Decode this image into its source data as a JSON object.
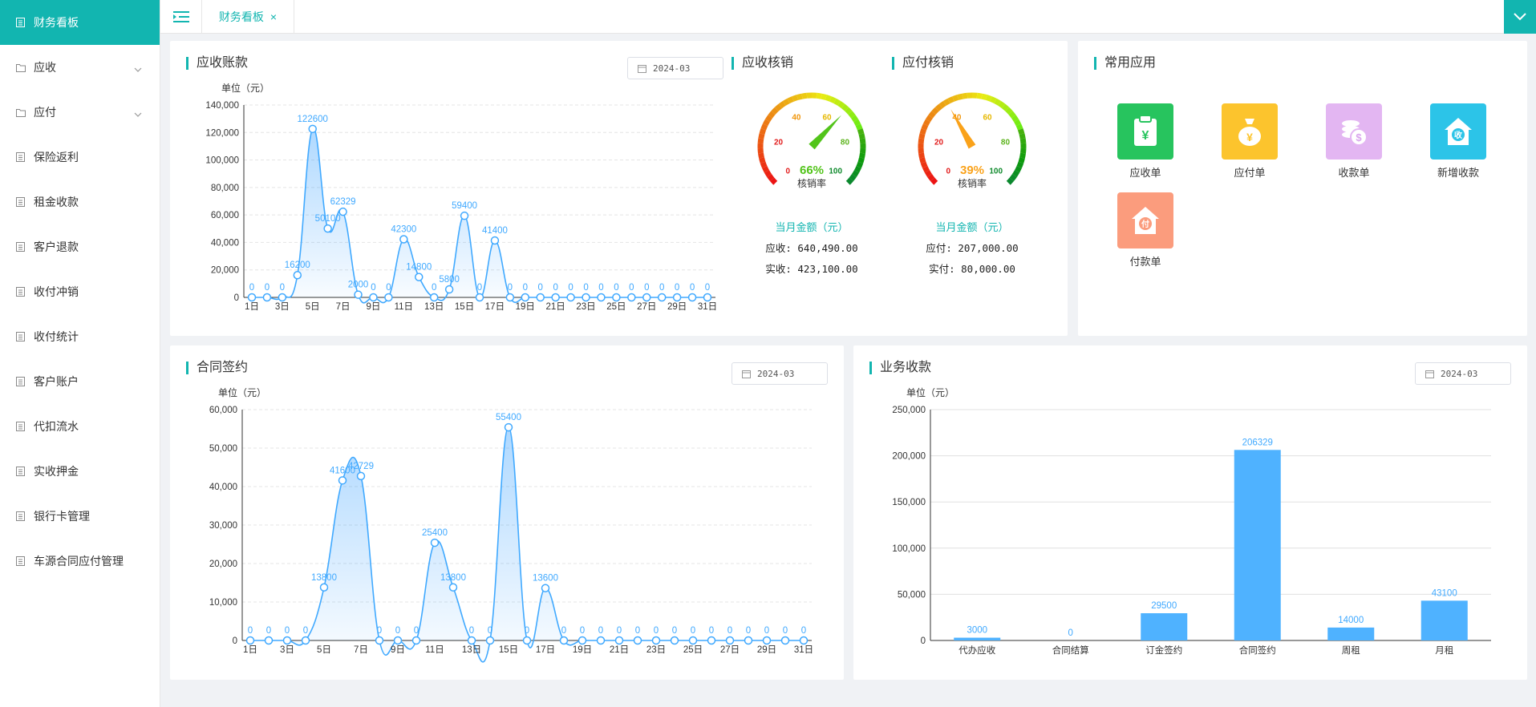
{
  "sidebar": {
    "items": [
      {
        "label": "财务看板",
        "active": true
      },
      {
        "label": "应收",
        "expandable": true
      },
      {
        "label": "应付",
        "expandable": true
      },
      {
        "label": "保险返利"
      },
      {
        "label": "租金收款"
      },
      {
        "label": "客户退款"
      },
      {
        "label": "收付冲销"
      },
      {
        "label": "收付统计"
      },
      {
        "label": "客户账户"
      },
      {
        "label": "代扣流水"
      },
      {
        "label": "实收押金"
      },
      {
        "label": "银行卡管理"
      },
      {
        "label": "车源合同应付管理"
      }
    ]
  },
  "topbar": {
    "tab_label": "财务看板",
    "tab_close": "×"
  },
  "receivables": {
    "title": "应收账款",
    "date": "2024-03",
    "unit": "单位（元）",
    "chart_data": {
      "type": "area",
      "x": [
        "1日",
        "2日",
        "3日",
        "4日",
        "5日",
        "6日",
        "7日",
        "8日",
        "9日",
        "10日",
        "11日",
        "12日",
        "13日",
        "14日",
        "15日",
        "16日",
        "17日",
        "18日",
        "19日",
        "20日",
        "21日",
        "22日",
        "23日",
        "24日",
        "25日",
        "26日",
        "27日",
        "28日",
        "29日",
        "30日",
        "31日"
      ],
      "xticks": [
        "1日",
        "3日",
        "5日",
        "7日",
        "9日",
        "11日",
        "13日",
        "15日",
        "17日",
        "19日",
        "21日",
        "23日",
        "25日",
        "27日",
        "29日",
        "31日"
      ],
      "values": [
        0,
        0,
        0,
        16200,
        122600,
        50100,
        62329,
        2000,
        0,
        0,
        42300,
        14800,
        0,
        5800,
        59400,
        0,
        41400,
        0,
        0,
        0,
        0,
        0,
        0,
        0,
        0,
        0,
        0,
        0,
        0,
        0,
        0
      ],
      "labels": [
        "0",
        "0",
        "0",
        "16200",
        "122600",
        "50100",
        "62329",
        "2000",
        "0",
        "0",
        "42300",
        "14800",
        "0",
        "5800",
        "59400",
        "0",
        "41400",
        "0",
        "0",
        "0",
        "0",
        "0",
        "0",
        "0",
        "0",
        "0",
        "0",
        "0",
        "0",
        "0",
        "0"
      ],
      "yticks": [
        "0",
        "20,000",
        "40,000",
        "60,000",
        "80,000",
        "100,000",
        "120,000",
        "140,000"
      ],
      "ylim": [
        0,
        140000
      ]
    }
  },
  "ar_writeoff": {
    "title": "应收核销",
    "gauge": {
      "value": 66,
      "label": "66%",
      "caption": "核销率",
      "ticks": [
        "0",
        "20",
        "40",
        "60",
        "80",
        "100"
      ],
      "color": "#52c41a"
    },
    "amount_title": "当月金额（元）",
    "line1": "应收: 640,490.00",
    "line2": "实收: 423,100.00"
  },
  "ap_writeoff": {
    "title": "应付核销",
    "gauge": {
      "value": 39,
      "label": "39%",
      "caption": "核销率",
      "ticks": [
        "0",
        "20",
        "40",
        "60",
        "80",
        "100"
      ],
      "color": "#faa21a"
    },
    "amount_title": "当月金额（元）",
    "line1": "应付: 207,000.00",
    "line2": "实付: 80,000.00"
  },
  "common_apps": {
    "title": "常用应用",
    "items": [
      {
        "label": "应收单",
        "color": "#27c45e",
        "icon": "clipboard-yen-icon"
      },
      {
        "label": "应付单",
        "color": "#fcc42d",
        "icon": "money-bag-icon"
      },
      {
        "label": "收款单",
        "color": "#e3b6f2",
        "icon": "coins-icon"
      },
      {
        "label": "新增收款",
        "color": "#2cc4e8",
        "icon": "house-receive-icon"
      },
      {
        "label": "付款单",
        "color": "#fb9c7d",
        "icon": "house-pay-icon"
      }
    ]
  },
  "contracts": {
    "title": "合同签约",
    "date": "2024-03",
    "unit": "单位（元）",
    "chart_data": {
      "type": "area",
      "x": [
        "1日",
        "2日",
        "3日",
        "4日",
        "5日",
        "6日",
        "7日",
        "8日",
        "9日",
        "10日",
        "11日",
        "12日",
        "13日",
        "14日",
        "15日",
        "16日",
        "17日",
        "18日",
        "19日",
        "20日",
        "21日",
        "22日",
        "23日",
        "24日",
        "25日",
        "26日",
        "27日",
        "28日",
        "29日",
        "30日",
        "31日"
      ],
      "xticks": [
        "1日",
        "3日",
        "5日",
        "7日",
        "9日",
        "11日",
        "13日",
        "15日",
        "17日",
        "19日",
        "21日",
        "23日",
        "25日",
        "27日",
        "29日",
        "31日"
      ],
      "values": [
        0,
        0,
        0,
        0,
        13800,
        41600,
        42729,
        0,
        0,
        0,
        25400,
        13800,
        0,
        0,
        55400,
        0,
        13600,
        0,
        0,
        0,
        0,
        0,
        0,
        0,
        0,
        0,
        0,
        0,
        0,
        0,
        0
      ],
      "labels": [
        "0",
        "0",
        "0",
        "0",
        "13800",
        "41600",
        "42729",
        "0",
        "0",
        "0",
        "25400",
        "13800",
        "0",
        "0",
        "55400",
        "0",
        "13600",
        "0",
        "0",
        "0",
        "0",
        "0",
        "0",
        "0",
        "0",
        "0",
        "0",
        "0",
        "0",
        "0",
        "0"
      ],
      "yticks": [
        "0",
        "10,000",
        "20,000",
        "30,000",
        "40,000",
        "50,000",
        "60,000"
      ],
      "ylim": [
        0,
        60000
      ]
    }
  },
  "business": {
    "title": "业务收款",
    "date": "2024-03",
    "unit": "单位（元）",
    "chart_data": {
      "type": "bar",
      "categories": [
        "代办应收",
        "合同结算",
        "订金签约",
        "合同签约",
        "周租",
        "月租"
      ],
      "values": [
        3000,
        0,
        29500,
        206329,
        14000,
        43100
      ],
      "labels": [
        "3000",
        "0",
        "29500",
        "206329",
        "14000",
        "43100"
      ],
      "yticks": [
        "0",
        "50,000",
        "100,000",
        "150,000",
        "200,000",
        "250,000"
      ],
      "ylim": [
        0,
        250000
      ]
    }
  },
  "colors": {
    "accent": "#12b5b0",
    "series": "#40a9ff",
    "bar": "#4fb2ff"
  }
}
